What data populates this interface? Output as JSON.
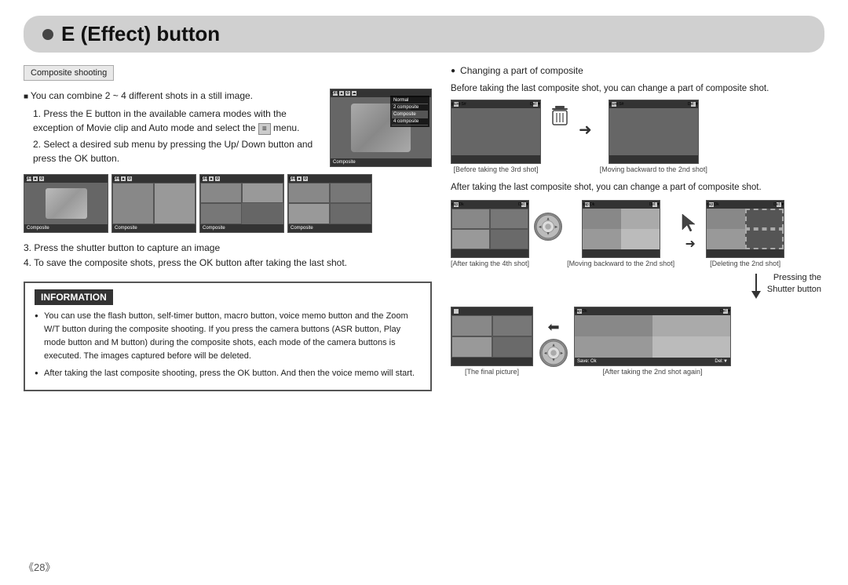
{
  "title": "E (Effect) button",
  "composite_tag": "Composite shooting",
  "left": {
    "intro_bullet": "You can combine 2 ~ 4 different shots in a still image.",
    "step1": "1. Press the E button in the available camera modes with the exception of Movie clip and Auto mode and select the",
    "step1_menu": "menu.",
    "step2": "2. Select a desired sub menu by pressing the Up/ Down button and press the OK button.",
    "step3": "3. Press the shutter button to capture an image",
    "step4": "4. To save the composite shots, press the OK button after taking the last shot.",
    "composite_images": [
      {
        "label": "Composite"
      },
      {
        "label": "Composite"
      },
      {
        "label": "Composite"
      },
      {
        "label": "Composite"
      }
    ],
    "info_title": "INFORMATION",
    "info_bullets": [
      "You can use the flash button, self-timer button, macro button, voice memo button and the Zoom W/T button during the composite shooting. If you press the camera buttons (ASR button, Play mode button and M button) during the composite shots, each mode of the camera buttons is executed. The images captured before will be deleted.",
      "After taking the last composite shooting, press the OK button. And then the voice memo will start."
    ]
  },
  "right": {
    "changing_title": "Changing a part of composite",
    "changing_desc": "Before taking the last composite shot, you can change a part of composite shot.",
    "before_3rd_label": "[Before taking the 3rd shot]",
    "move_back_2nd_label": "[Moving backward to the 2nd shot]",
    "after_desc": "After taking the last composite shot, you can change a part of composite shot.",
    "after_4th_label": "[After taking the 4th shot]",
    "move_back_2nd_label2": "[Moving backward to the 2nd shot]",
    "deleting_2nd_label": "[Deleting the 2nd shot]",
    "pressing_note_line1": "Pressing the",
    "pressing_note_line2": "Shutter button",
    "final_pic_label": "[The final picture]",
    "after_2nd_again_label": "[After taking the 2nd shot again]"
  },
  "page_number": "《28》"
}
